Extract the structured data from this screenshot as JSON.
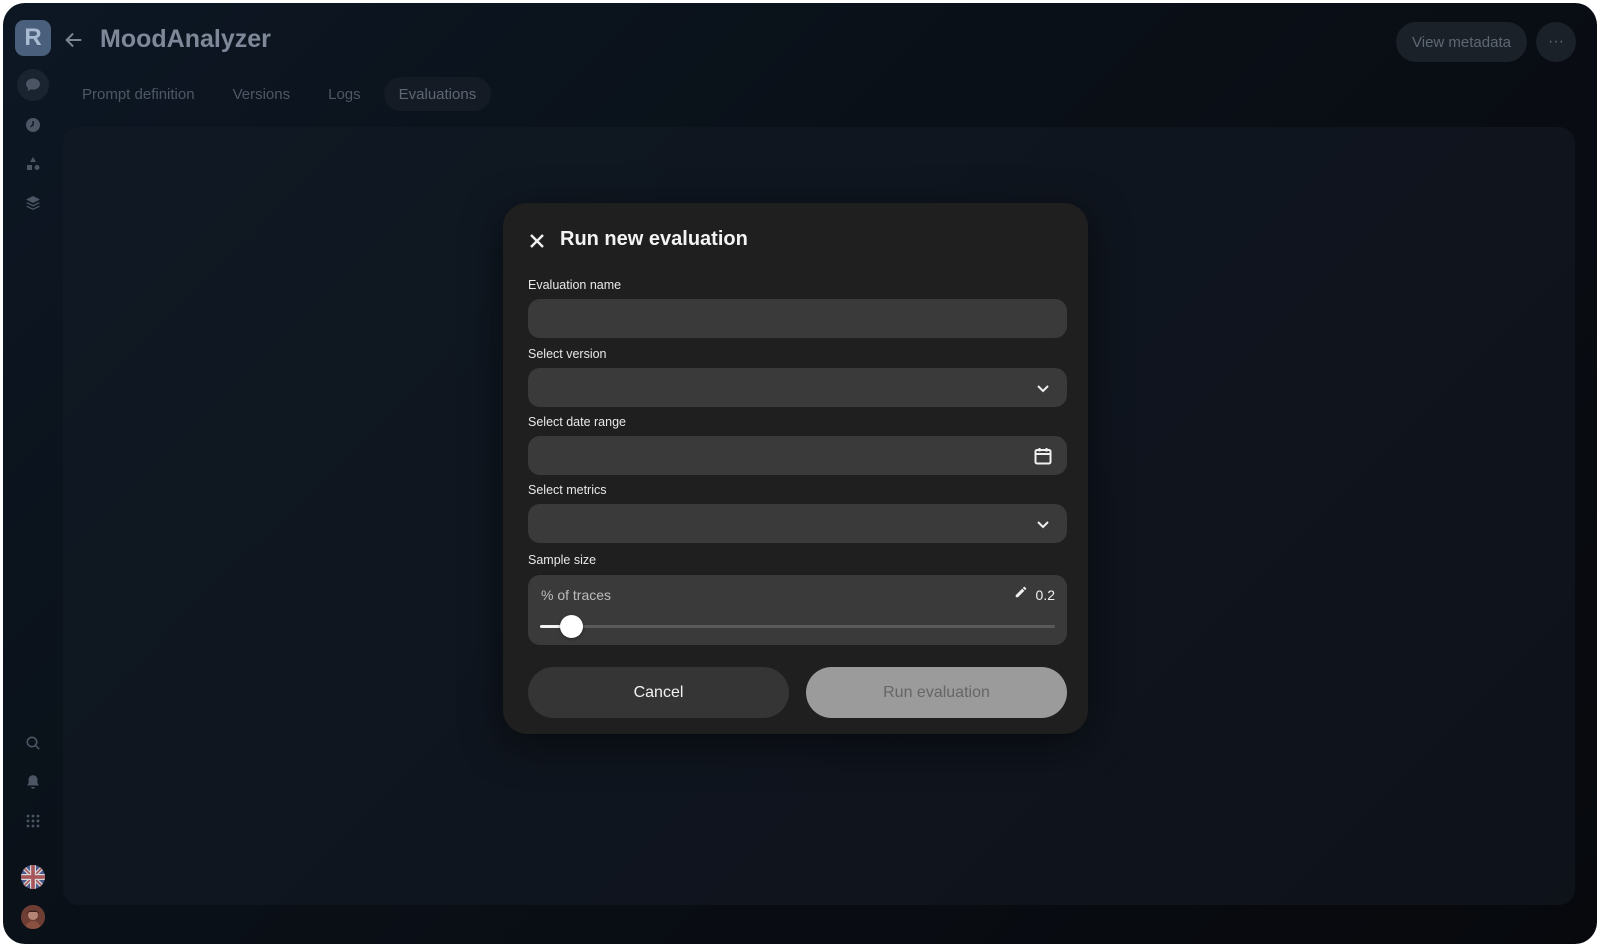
{
  "app": {
    "logo_letter": "R",
    "title": "MoodAnalyzer",
    "view_metadata_label": "View metadata",
    "more_label": "···"
  },
  "tabs": [
    {
      "label": "Prompt definition",
      "active": false
    },
    {
      "label": "Versions",
      "active": false
    },
    {
      "label": "Logs",
      "active": false
    },
    {
      "label": "Evaluations",
      "active": true
    }
  ],
  "rail": {
    "top_icons": [
      "chat-icon",
      "clock-icon",
      "shapes-icon",
      "layers-icon"
    ],
    "bottom_icons": [
      "search-icon",
      "bell-icon",
      "apps-grid-icon",
      "uk-flag-icon",
      "avatar"
    ]
  },
  "modal": {
    "title": "Run new evaluation",
    "evaluation_name_label": "Evaluation name",
    "evaluation_name_value": "",
    "select_version_label": "Select version",
    "select_version_value": "",
    "date_range_label": "Select date range",
    "date_range_value": "",
    "metrics_label": "Select metrics",
    "metrics_value": "",
    "sample_size_label": "Sample size",
    "sample_unit_label": "% of traces",
    "sample_value": "0.2",
    "sample_fraction": 0.06,
    "cancel_label": "Cancel",
    "run_label": "Run evaluation"
  },
  "colors": {
    "background": "#0a1119",
    "modal_bg": "#1f1f1f",
    "field_bg": "#3a3a3a",
    "run_button_disabled": "#9b9b9b"
  }
}
